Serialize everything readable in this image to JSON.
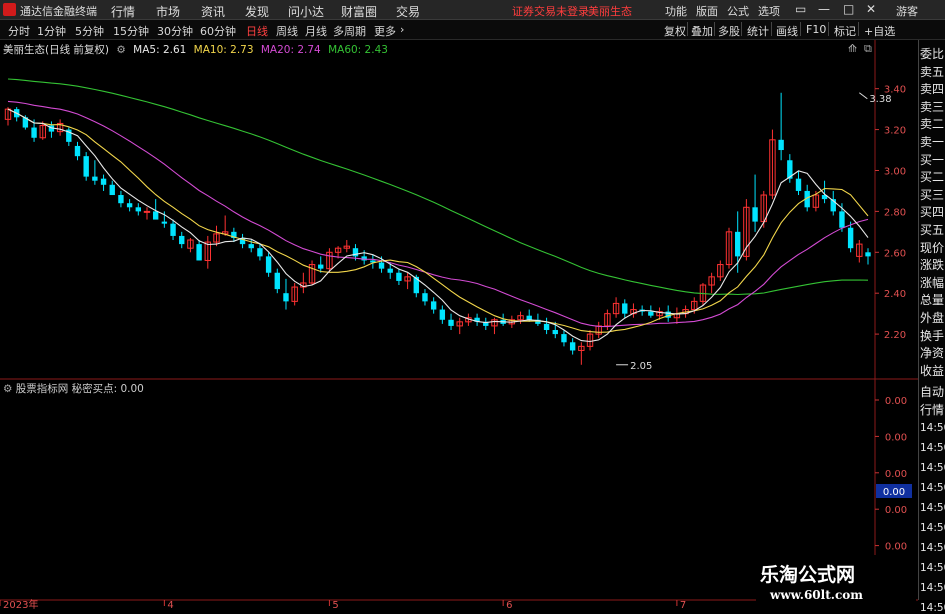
{
  "app": {
    "name": "通达信金融终端",
    "menu": [
      "行情",
      "市场",
      "资讯",
      "发现",
      "问小达",
      "财富圈",
      "交易"
    ],
    "warning": "证券交易未登录",
    "stock_tab": "美丽生态",
    "right_menu": [
      "功能",
      "版面",
      "公式",
      "选项"
    ],
    "guest": "游客"
  },
  "periods": {
    "items": [
      "分时",
      "1分钟",
      "5分钟",
      "15分钟",
      "30分钟",
      "60分钟",
      "日线",
      "周线",
      "月线",
      "多周期",
      "更多"
    ],
    "active": "日线"
  },
  "tools": [
    "复权",
    "叠加",
    "多股",
    "统计",
    "画线",
    "F10",
    "标记",
    "+自选"
  ],
  "main_info": {
    "name": "美丽生态(日线 前复权)",
    "ma5": "MA5: 2.61",
    "ma10": "MA10: 2.73",
    "ma20": "MA20: 2.74",
    "ma60": "MA60: 2.43"
  },
  "indicator": {
    "title": "股票指标网",
    "value": "秘密买点: 0.00",
    "axis_labels": [
      "0.00",
      "0.00",
      "0.00",
      "0.00",
      "0.00",
      "0.00"
    ],
    "current": "0.00"
  },
  "right_strip": {
    "labels": [
      "委比",
      "卖五",
      "卖四",
      "卖三",
      "卖二",
      "卖一",
      "买一",
      "买二",
      "买三",
      "买四",
      "买五",
      "现价",
      "涨跌",
      "涨幅",
      "总量",
      "外盘",
      "换手",
      "净资",
      "收益"
    ],
    "lower": [
      "自动",
      "行情"
    ],
    "times": [
      "14:50",
      "14:50",
      "14:50",
      "14:50",
      "14:50",
      "14:50",
      "14:50",
      "14:50",
      "14:50",
      "14:50"
    ]
  },
  "colors": {
    "up": "#ff3232",
    "down": "#00e4ff",
    "ma5": "#e8e8e8",
    "ma10": "#f2d64b",
    "ma20": "#d34bd3",
    "ma60": "#34c234"
  },
  "watermark": {
    "text": "乐淘公式网",
    "url": "www.60lt.com"
  },
  "chart_data": {
    "type": "candlestick",
    "ylim": [
      2.0,
      3.55
    ],
    "yticks": [
      2.2,
      2.4,
      2.6,
      2.8,
      3.0,
      3.2,
      3.4
    ],
    "xticks": [
      {
        "label": "2023年",
        "index": 0
      },
      {
        "label": "4",
        "index": 18
      },
      {
        "label": "5",
        "index": 37
      },
      {
        "label": "6",
        "index": 57
      },
      {
        "label": "7",
        "index": 77
      }
    ],
    "annotations": [
      {
        "label": "3.38",
        "index": 98,
        "value": 3.38
      },
      {
        "label": "2.05",
        "index": 70,
        "value": 2.05
      }
    ],
    "ohlc": [
      [
        3.25,
        3.31,
        3.22,
        3.3
      ],
      [
        3.3,
        3.31,
        3.24,
        3.26
      ],
      [
        3.26,
        3.27,
        3.2,
        3.21
      ],
      [
        3.21,
        3.25,
        3.14,
        3.16
      ],
      [
        3.16,
        3.24,
        3.15,
        3.22
      ],
      [
        3.22,
        3.24,
        3.16,
        3.19
      ],
      [
        3.19,
        3.25,
        3.17,
        3.23
      ],
      [
        3.2,
        3.21,
        3.12,
        3.14
      ],
      [
        3.12,
        3.14,
        3.05,
        3.07
      ],
      [
        3.07,
        3.09,
        2.95,
        2.97
      ],
      [
        2.97,
        3.05,
        2.93,
        2.95
      ],
      [
        2.96,
        2.98,
        2.9,
        2.93
      ],
      [
        2.93,
        2.95,
        2.88,
        2.88
      ],
      [
        2.88,
        2.9,
        2.82,
        2.84
      ],
      [
        2.84,
        2.86,
        2.8,
        2.82
      ],
      [
        2.82,
        2.84,
        2.78,
        2.8
      ],
      [
        2.8,
        2.82,
        2.76,
        2.8
      ],
      [
        2.8,
        2.86,
        2.78,
        2.76
      ],
      [
        2.75,
        2.8,
        2.72,
        2.74
      ],
      [
        2.74,
        2.76,
        2.66,
        2.68
      ],
      [
        2.68,
        2.7,
        2.62,
        2.64
      ],
      [
        2.62,
        2.67,
        2.6,
        2.66
      ],
      [
        2.64,
        2.66,
        2.56,
        2.56
      ],
      [
        2.56,
        2.68,
        2.52,
        2.65
      ],
      [
        2.65,
        2.73,
        2.63,
        2.69
      ],
      [
        2.69,
        2.78,
        2.68,
        2.7
      ],
      [
        2.7,
        2.72,
        2.65,
        2.67
      ],
      [
        2.67,
        2.69,
        2.62,
        2.64
      ],
      [
        2.64,
        2.66,
        2.6,
        2.62
      ],
      [
        2.62,
        2.64,
        2.56,
        2.58
      ],
      [
        2.58,
        2.6,
        2.48,
        2.5
      ],
      [
        2.5,
        2.52,
        2.4,
        2.42
      ],
      [
        2.4,
        2.47,
        2.32,
        2.36
      ],
      [
        2.36,
        2.45,
        2.34,
        2.43
      ],
      [
        2.43,
        2.5,
        2.4,
        2.45
      ],
      [
        2.45,
        2.56,
        2.44,
        2.54
      ],
      [
        2.54,
        2.58,
        2.5,
        2.52
      ],
      [
        2.52,
        2.62,
        2.5,
        2.6
      ],
      [
        2.6,
        2.63,
        2.57,
        2.62
      ],
      [
        2.62,
        2.66,
        2.6,
        2.63
      ],
      [
        2.62,
        2.64,
        2.56,
        2.58
      ],
      [
        2.58,
        2.61,
        2.54,
        2.56
      ],
      [
        2.56,
        2.59,
        2.52,
        2.55
      ],
      [
        2.55,
        2.58,
        2.5,
        2.52
      ],
      [
        2.52,
        2.55,
        2.47,
        2.5
      ],
      [
        2.5,
        2.52,
        2.44,
        2.46
      ],
      [
        2.46,
        2.5,
        2.42,
        2.48
      ],
      [
        2.48,
        2.49,
        2.38,
        2.4
      ],
      [
        2.4,
        2.42,
        2.34,
        2.36
      ],
      [
        2.36,
        2.38,
        2.3,
        2.32
      ],
      [
        2.32,
        2.34,
        2.25,
        2.27
      ],
      [
        2.27,
        2.3,
        2.22,
        2.24
      ],
      [
        2.24,
        2.28,
        2.2,
        2.26
      ],
      [
        2.26,
        2.3,
        2.24,
        2.28
      ],
      [
        2.28,
        2.3,
        2.24,
        2.26
      ],
      [
        2.26,
        2.28,
        2.22,
        2.24
      ],
      [
        2.24,
        2.28,
        2.2,
        2.27
      ],
      [
        2.27,
        2.3,
        2.24,
        2.25
      ],
      [
        2.25,
        2.29,
        2.23,
        2.27
      ],
      [
        2.27,
        2.31,
        2.25,
        2.29
      ],
      [
        2.29,
        2.32,
        2.26,
        2.27
      ],
      [
        2.27,
        2.3,
        2.24,
        2.25
      ],
      [
        2.25,
        2.28,
        2.2,
        2.22
      ],
      [
        2.22,
        2.26,
        2.18,
        2.2
      ],
      [
        2.2,
        2.22,
        2.14,
        2.16
      ],
      [
        2.16,
        2.18,
        2.1,
        2.12
      ],
      [
        2.12,
        2.16,
        2.05,
        2.14
      ],
      [
        2.14,
        2.22,
        2.12,
        2.2
      ],
      [
        2.2,
        2.26,
        2.18,
        2.24
      ],
      [
        2.24,
        2.32,
        2.22,
        2.3
      ],
      [
        2.3,
        2.38,
        2.28,
        2.35
      ],
      [
        2.35,
        2.37,
        2.28,
        2.3
      ],
      [
        2.3,
        2.35,
        2.28,
        2.32
      ],
      [
        2.32,
        2.34,
        2.29,
        2.31
      ],
      [
        2.31,
        2.34,
        2.28,
        2.29
      ],
      [
        2.29,
        2.33,
        2.27,
        2.31
      ],
      [
        2.31,
        2.34,
        2.26,
        2.28
      ],
      [
        2.28,
        2.33,
        2.25,
        2.3
      ],
      [
        2.3,
        2.34,
        2.28,
        2.32
      ],
      [
        2.32,
        2.38,
        2.3,
        2.36
      ],
      [
        2.36,
        2.45,
        2.34,
        2.44
      ],
      [
        2.44,
        2.5,
        2.4,
        2.48
      ],
      [
        2.48,
        2.56,
        2.46,
        2.54
      ],
      [
        2.54,
        2.72,
        2.52,
        2.7
      ],
      [
        2.7,
        2.8,
        2.5,
        2.58
      ],
      [
        2.58,
        2.86,
        2.56,
        2.82
      ],
      [
        2.82,
        2.98,
        2.7,
        2.75
      ],
      [
        2.75,
        2.9,
        2.72,
        2.88
      ],
      [
        2.88,
        3.2,
        2.86,
        3.15
      ],
      [
        3.15,
        3.38,
        3.05,
        3.1
      ],
      [
        3.05,
        3.08,
        2.94,
        2.96
      ],
      [
        2.96,
        3.0,
        2.88,
        2.9
      ],
      [
        2.9,
        2.93,
        2.8,
        2.82
      ],
      [
        2.82,
        2.9,
        2.8,
        2.88
      ],
      [
        2.88,
        2.95,
        2.84,
        2.86
      ],
      [
        2.86,
        2.9,
        2.78,
        2.8
      ],
      [
        2.8,
        2.84,
        2.7,
        2.72
      ],
      [
        2.72,
        2.75,
        2.6,
        2.62
      ],
      [
        2.58,
        2.66,
        2.55,
        2.64
      ],
      [
        2.6,
        2.62,
        2.54,
        2.58
      ]
    ]
  }
}
